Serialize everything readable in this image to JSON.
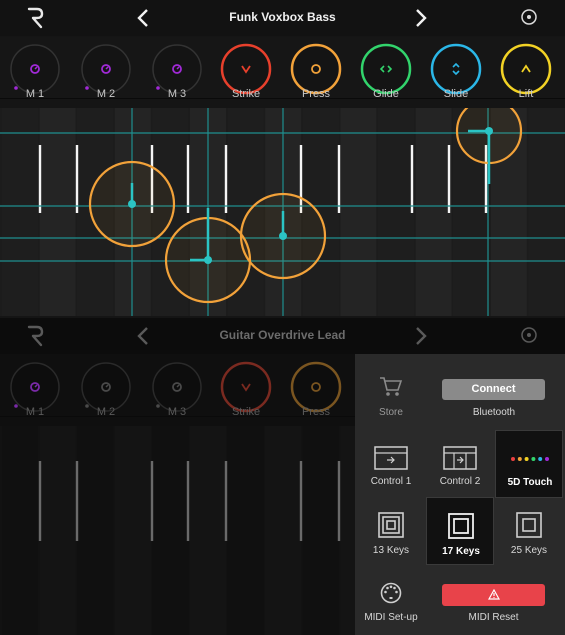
{
  "top": {
    "title": "Funk Voxbox Bass",
    "knobs": [
      {
        "label": "M 1",
        "color": "#a22ad8",
        "icon": "dial-icon",
        "level": 0.02
      },
      {
        "label": "M 2",
        "color": "#a22ad8",
        "icon": "dial-icon",
        "level": 0.02
      },
      {
        "label": "M 3",
        "color": "#a22ad8",
        "icon": "dial-icon",
        "level": 0.02
      },
      {
        "label": "Strike",
        "color": "#e8402c",
        "icon": "chevron-down-icon",
        "level": 1
      },
      {
        "label": "Press",
        "color": "#f2a23a",
        "icon": "circle-icon",
        "level": 1
      },
      {
        "label": "Glide",
        "color": "#32d46c",
        "icon": "horizontal-arrows-icon",
        "level": 1
      },
      {
        "label": "Slide",
        "color": "#2bb7e8",
        "icon": "vertical-arrows-icon",
        "level": 1
      },
      {
        "label": "Lift",
        "color": "#f2d225",
        "icon": "chevron-up-icon",
        "level": 1
      }
    ]
  },
  "bottom": {
    "title": "Guitar Overdrive Lead",
    "knobs": [
      {
        "label": "M 1",
        "color": "#7a2aa8",
        "icon": "dial-icon"
      },
      {
        "label": "M 2",
        "color": "#4a4a4a",
        "icon": "dial-icon"
      },
      {
        "label": "M 3",
        "color": "#4a4a4a",
        "icon": "dial-icon"
      },
      {
        "label": "Strike",
        "color": "#7a2a20",
        "icon": "chevron-down-icon"
      },
      {
        "label": "Press",
        "color": "#7a5520",
        "icon": "circle-icon"
      }
    ]
  },
  "menu": {
    "store": "Store",
    "connect": "Connect",
    "bluetooth": "Bluetooth",
    "control1": "Control 1",
    "control2": "Control 2",
    "touch5d": "5D Touch",
    "keys13": "13 Keys",
    "keys17": "17 Keys",
    "keys25": "25 Keys",
    "midi_setup": "MIDI Set-up",
    "midi_reset": "MIDI Reset"
  },
  "colors": {
    "touch_ring": "#f2a23a",
    "touch_marker": "#2bc4c4",
    "grid_line": "#1f8f8f",
    "reset": "#e8434a",
    "touch_dots": [
      "#e84040",
      "#f2a23a",
      "#f2d225",
      "#32d46c",
      "#2bb7e8",
      "#a22ad8"
    ]
  }
}
